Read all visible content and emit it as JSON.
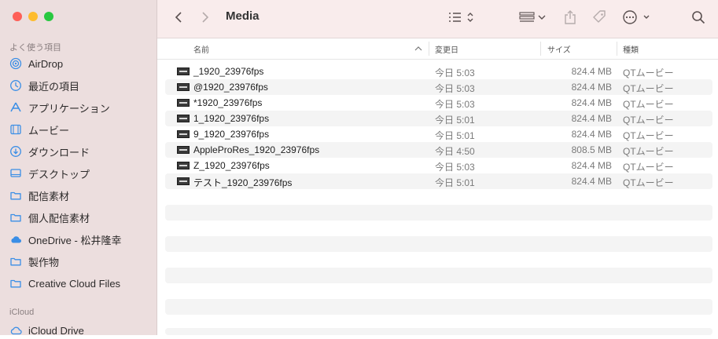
{
  "window": {
    "title": "Media"
  },
  "colors": {
    "close": "#fe5f57",
    "minimize": "#febc2e",
    "zoom": "#28c840",
    "sidebar_icon": "#3a8ee6"
  },
  "sidebar": {
    "favorites_title": "よく使う項目",
    "favorites": [
      {
        "label": "AirDrop",
        "icon": "airdrop-icon"
      },
      {
        "label": "最近の項目",
        "icon": "clock-icon"
      },
      {
        "label": "アプリケーション",
        "icon": "apps-icon"
      },
      {
        "label": "ムービー",
        "icon": "film-icon"
      },
      {
        "label": "ダウンロード",
        "icon": "download-icon"
      },
      {
        "label": "デスクトップ",
        "icon": "desktop-icon"
      },
      {
        "label": "配信素材",
        "icon": "folder-icon"
      },
      {
        "label": "個人配信素材",
        "icon": "folder-icon"
      },
      {
        "label": "OneDrive - 松井隆幸",
        "icon": "cloud-icon"
      },
      {
        "label": "製作物",
        "icon": "folder-icon"
      },
      {
        "label": "Creative Cloud Files",
        "icon": "folder-icon"
      }
    ],
    "icloud_title": "iCloud",
    "icloud": [
      {
        "label": "iCloud Drive",
        "icon": "cloud-icon"
      }
    ]
  },
  "columns": {
    "name": "名前",
    "date": "変更日",
    "size": "サイズ",
    "kind": "種類"
  },
  "files": [
    {
      "name": "_1920_23976fps",
      "date": "今日 5:03",
      "size": "824.4 MB",
      "kind": "QTムービー"
    },
    {
      "name": "@1920_23976fps",
      "date": "今日 5:03",
      "size": "824.4 MB",
      "kind": "QTムービー"
    },
    {
      "name": "*1920_23976fps",
      "date": "今日 5:03",
      "size": "824.4 MB",
      "kind": "QTムービー"
    },
    {
      "name": "1_1920_23976fps",
      "date": "今日 5:01",
      "size": "824.4 MB",
      "kind": "QTムービー"
    },
    {
      "name": "9_1920_23976fps",
      "date": "今日 5:01",
      "size": "824.4 MB",
      "kind": "QTムービー"
    },
    {
      "name": "AppleProRes_1920_23976fps",
      "date": "今日 4:50",
      "size": "808.5 MB",
      "kind": "QTムービー"
    },
    {
      "name": "Z_1920_23976fps",
      "date": "今日 5:03",
      "size": "824.4 MB",
      "kind": "QTムービー"
    },
    {
      "name": "テスト_1920_23976fps",
      "date": "今日 5:01",
      "size": "824.4 MB",
      "kind": "QTムービー"
    }
  ]
}
